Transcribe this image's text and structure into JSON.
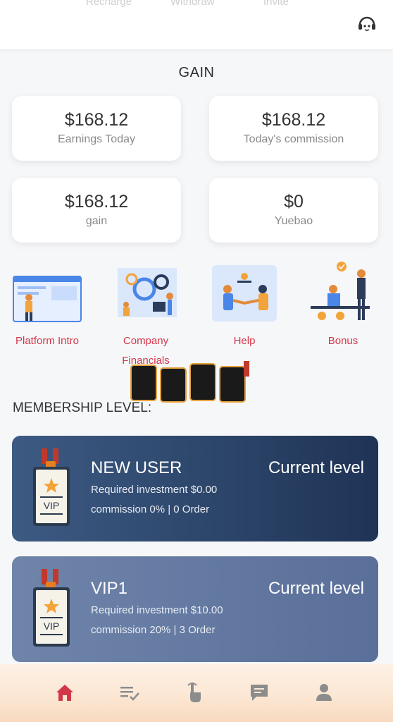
{
  "topnav": {
    "recharge": "Recharge",
    "withdraw": "Withdraw",
    "invite": "Invite"
  },
  "section_title": "GAIN",
  "stats": [
    {
      "value": "$168.12",
      "label": "Earnings Today"
    },
    {
      "value": "$168.12",
      "label": "Today's commission"
    },
    {
      "value": "$168.12",
      "label": "gain"
    },
    {
      "value": "$0",
      "label": "Yuebao"
    }
  ],
  "quick_links": [
    {
      "label": "Platform Intro"
    },
    {
      "label": "Company Financials"
    },
    {
      "label": "Help"
    },
    {
      "label": "Bonus"
    }
  ],
  "membership_title": "MEMBERSHIP LEVEL:",
  "levels": [
    {
      "name": "NEW USER",
      "status": "Current level",
      "required": "Required investment $0.00",
      "commission": "commission 0% | 0 Order"
    },
    {
      "name": "VIP1",
      "status": "Current level",
      "required": "Required investment $10.00",
      "commission": "commission 20% | 3 Order"
    }
  ],
  "colors": {
    "accent_red": "#d2384a",
    "card_dark": "#2b4468",
    "card_light": "#6278a0"
  },
  "icons": [
    "headset-icon",
    "home-icon",
    "list-check-icon",
    "tap-icon",
    "chat-icon",
    "user-icon",
    "vip-badge-icon"
  ]
}
